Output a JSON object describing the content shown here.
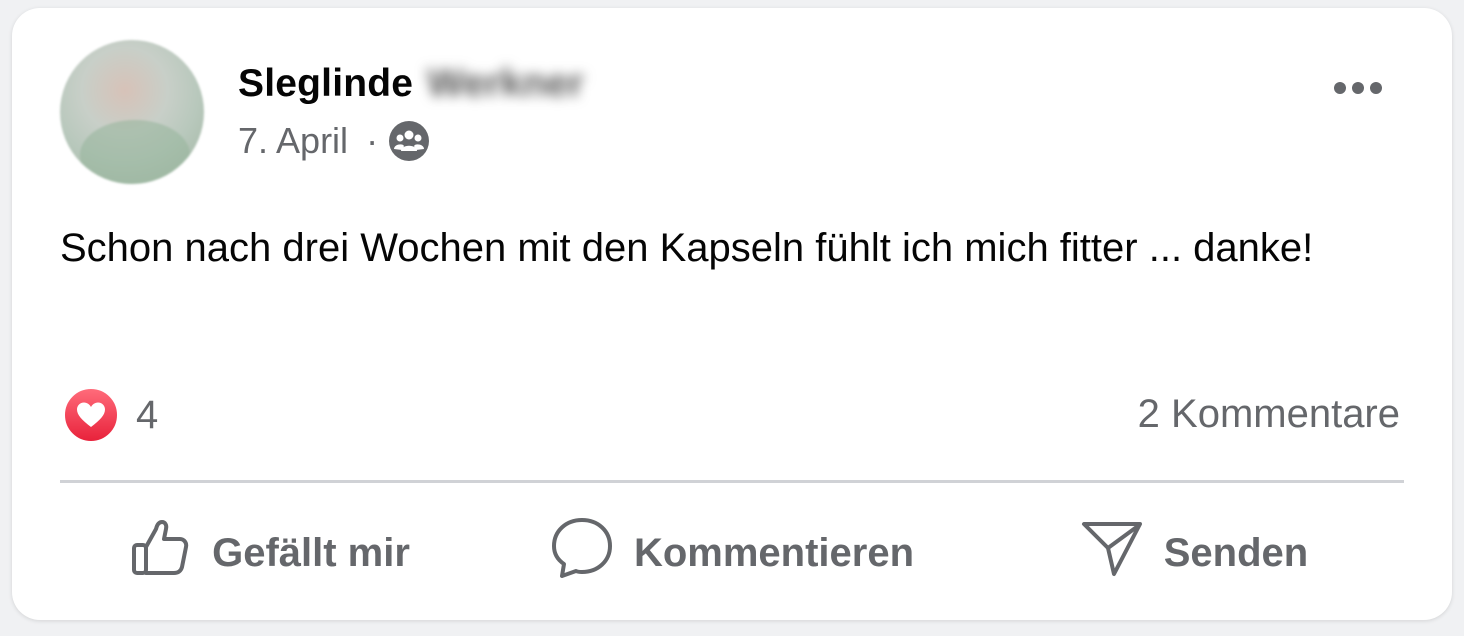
{
  "post": {
    "author_first": "Sleglinde",
    "author_last": "Werkner",
    "date": "7. April",
    "separator": "·",
    "audience_icon": "group-icon",
    "text": "Schon nach drei Wochen mit den Kapseln fühlt ich mich fitter ... danke!"
  },
  "engagement": {
    "reaction_icon": "heart-icon",
    "reaction_count": "4",
    "comments_label": "2 Kommentare"
  },
  "actions": {
    "like_label": "Gefällt mir",
    "comment_label": "Kommentieren",
    "send_label": "Senden"
  },
  "colors": {
    "text_primary": "#050505",
    "text_secondary": "#65676b",
    "heart_start": "#ff6b7a",
    "heart_end": "#e8223b",
    "divider": "#d0d2d6"
  }
}
